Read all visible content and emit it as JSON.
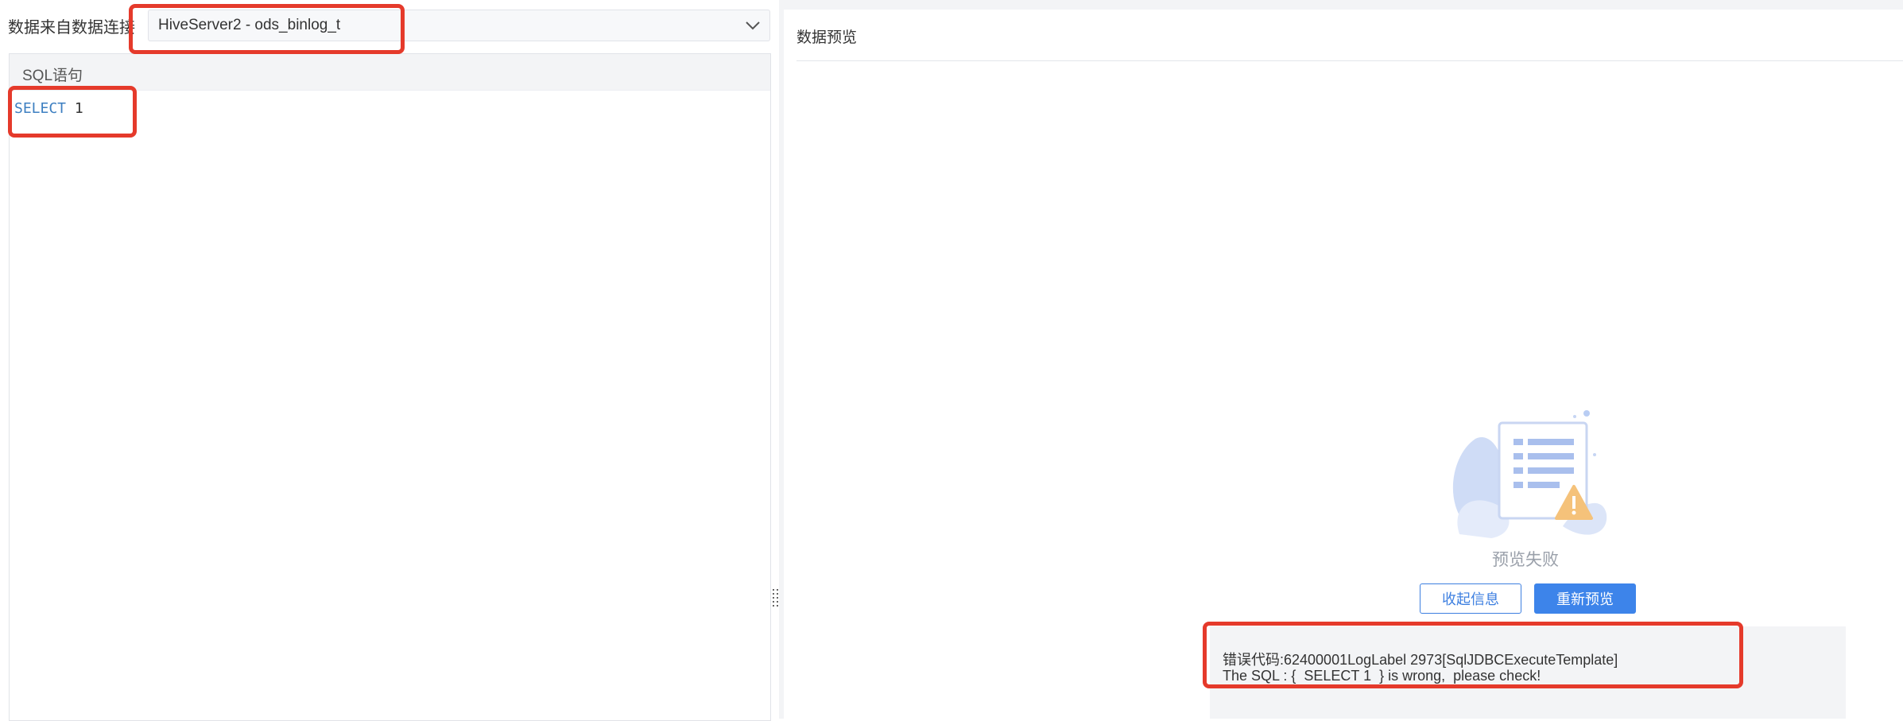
{
  "connection": {
    "label": "数据来自数据连接",
    "value": "HiveServer2 - ods_binlog_t"
  },
  "sql": {
    "header": "SQL语句",
    "keyword": "SELECT",
    "rest": " 1"
  },
  "preview": {
    "title": "数据预览",
    "status": "预览失败",
    "collapse_button": "收起信息",
    "retry_button": "重新预览",
    "error_line1": "错误代码:62400001LogLabel 2973[SqlJDBCExecuteTemplate]",
    "error_line2": "The SQL : {  SELECT 1  } is wrong,  please check!"
  },
  "colors": {
    "accent": "#3d84ea",
    "annotation": "#e53a2b"
  }
}
